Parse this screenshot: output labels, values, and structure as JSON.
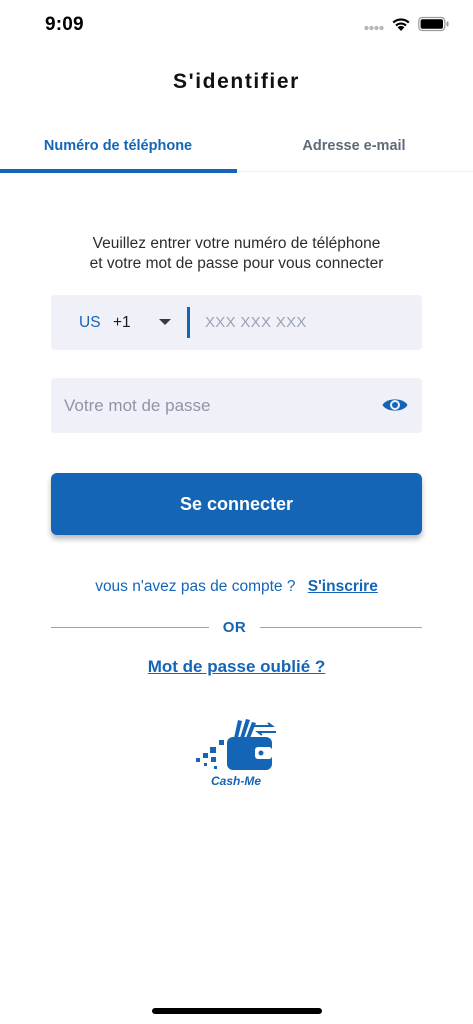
{
  "status_bar": {
    "time": "9:09",
    "icons": [
      "signal-icon",
      "wifi-icon",
      "battery-icon"
    ]
  },
  "header": {
    "title": "S'identifier"
  },
  "tabs": [
    {
      "label": "Numéro de téléphone",
      "active": true
    },
    {
      "label": "Adresse e-mail",
      "active": false
    }
  ],
  "form": {
    "instructions_line1": "Veuillez entrer votre numéro de téléphone",
    "instructions_line2": "et votre mot de passe pour vous connecter",
    "phone": {
      "country": "US",
      "dial_code": "+1",
      "placeholder": "XXX XXX XXX",
      "value": ""
    },
    "password": {
      "placeholder": "Votre mot de passe",
      "value": ""
    },
    "submit_label": "Se connecter"
  },
  "signup": {
    "prompt": "vous n'avez pas de compte ?",
    "link": "S'inscrire"
  },
  "divider_text": "OR",
  "forgot_password": "Mot de passe oublié ?",
  "logo": {
    "text": "Cash-Me"
  },
  "colors": {
    "accent": "#1565b7",
    "field_background": "#f0f0f9",
    "inactive_tab": "#5c6b7a"
  }
}
